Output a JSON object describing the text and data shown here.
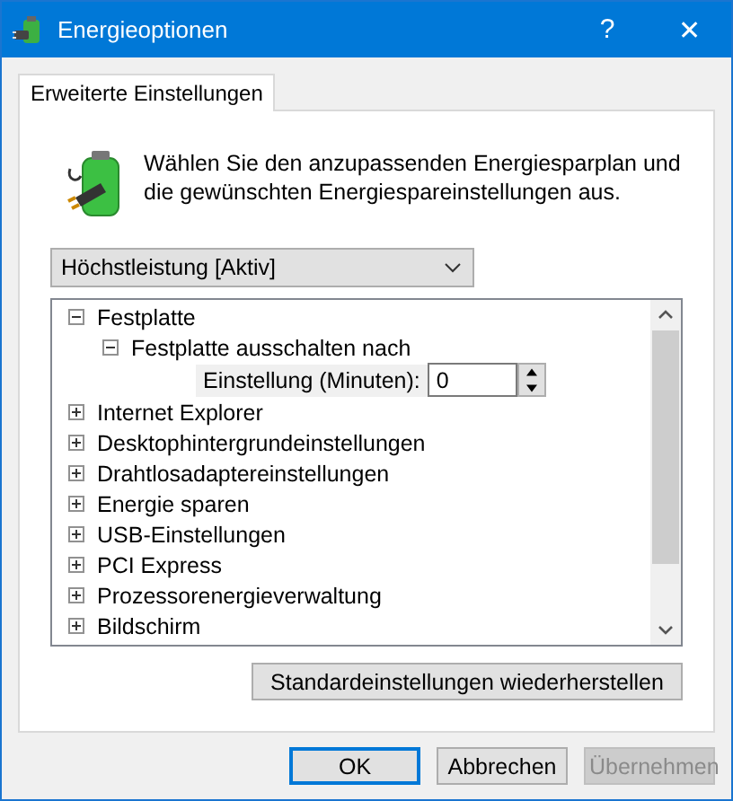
{
  "window": {
    "title": "Energieoptionen",
    "help": "?",
    "close": "✕"
  },
  "tabs": [
    {
      "label": "Erweiterte Einstellungen",
      "selected": true
    }
  ],
  "description": "Wählen Sie den anzupassenden Energiesparplan und die gewünschten Energiespareinstellungen aus.",
  "plan_dropdown": {
    "value": "Höchstleistung [Aktiv]"
  },
  "tree": [
    {
      "label": "Festplatte",
      "expanded": true,
      "children": [
        {
          "label": "Festplatte ausschalten nach",
          "expanded": true,
          "setting": {
            "label": "Einstellung (Minuten):",
            "value": "0"
          }
        }
      ]
    },
    {
      "label": "Internet Explorer",
      "expanded": false
    },
    {
      "label": "Desktophintergrundeinstellungen",
      "expanded": false
    },
    {
      "label": "Drahtlosadaptereinstellungen",
      "expanded": false
    },
    {
      "label": "Energie sparen",
      "expanded": false
    },
    {
      "label": "USB-Einstellungen",
      "expanded": false
    },
    {
      "label": "PCI Express",
      "expanded": false
    },
    {
      "label": "Prozessorenergieverwaltung",
      "expanded": false
    },
    {
      "label": "Bildschirm",
      "expanded": false
    }
  ],
  "restore_button": "Standardeinstellungen wiederherstellen",
  "buttons": [
    {
      "label": "OK",
      "default": true,
      "disabled": false
    },
    {
      "label": "Abbrechen",
      "default": false,
      "disabled": false
    },
    {
      "label": "Übernehmen",
      "default": false,
      "disabled": true
    }
  ]
}
